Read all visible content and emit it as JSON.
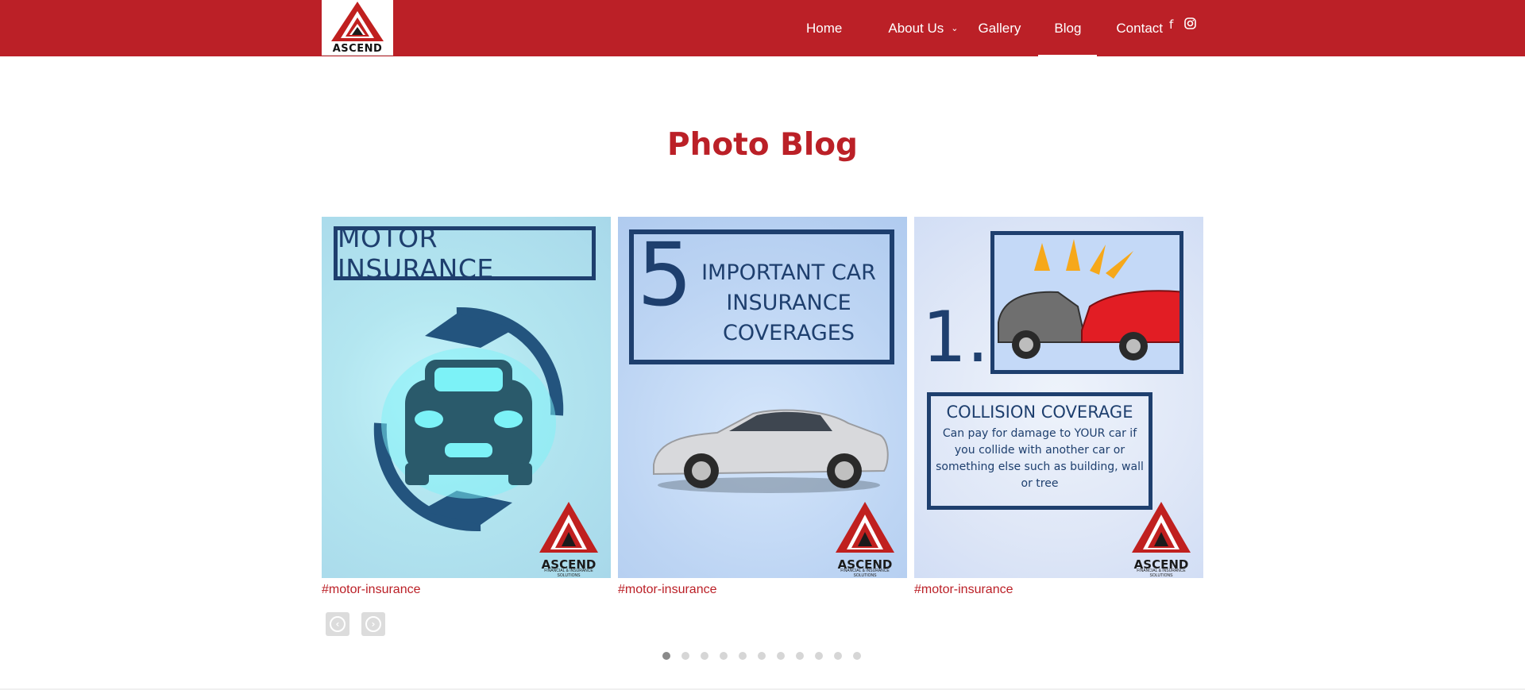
{
  "brand": {
    "logo_text": "ASCEND"
  },
  "nav": {
    "items": [
      {
        "label": "Home"
      },
      {
        "label": "About Us"
      },
      {
        "label": "Gallery"
      },
      {
        "label": "Blog"
      },
      {
        "label": "Contact"
      }
    ],
    "active": "Blog",
    "social": [
      "facebook-icon",
      "instagram-icon"
    ]
  },
  "page": {
    "title": "Photo Blog"
  },
  "posts": [
    {
      "image_text": "MOTOR INSURANCE",
      "brand_word": "ASCEND",
      "brand_sub": "FINANCIAL & INSURANCE SOLUTIONS",
      "tag": "#motor-insurance"
    },
    {
      "image_number": "5",
      "image_text": "IMPORTANT CAR INSURANCE COVERAGES",
      "brand_word": "ASCEND",
      "brand_sub": "FINANCIAL & INSURANCE SOLUTIONS",
      "tag": "#motor-insurance"
    },
    {
      "image_number": "1.",
      "heading": "COLLISION COVERAGE",
      "body": "Can pay for damage to YOUR car if you collide with another car or something else such as building, wall or tree",
      "brand_word": "ASCEND",
      "brand_sub": "FINANCIAL & INSURANCE SOLUTIONS",
      "tag": "#motor-insurance"
    }
  ],
  "carousel": {
    "dots": 11,
    "active_index": 0
  },
  "colors": {
    "brand_red": "#bb2027",
    "navy": "#1e3f6e"
  }
}
